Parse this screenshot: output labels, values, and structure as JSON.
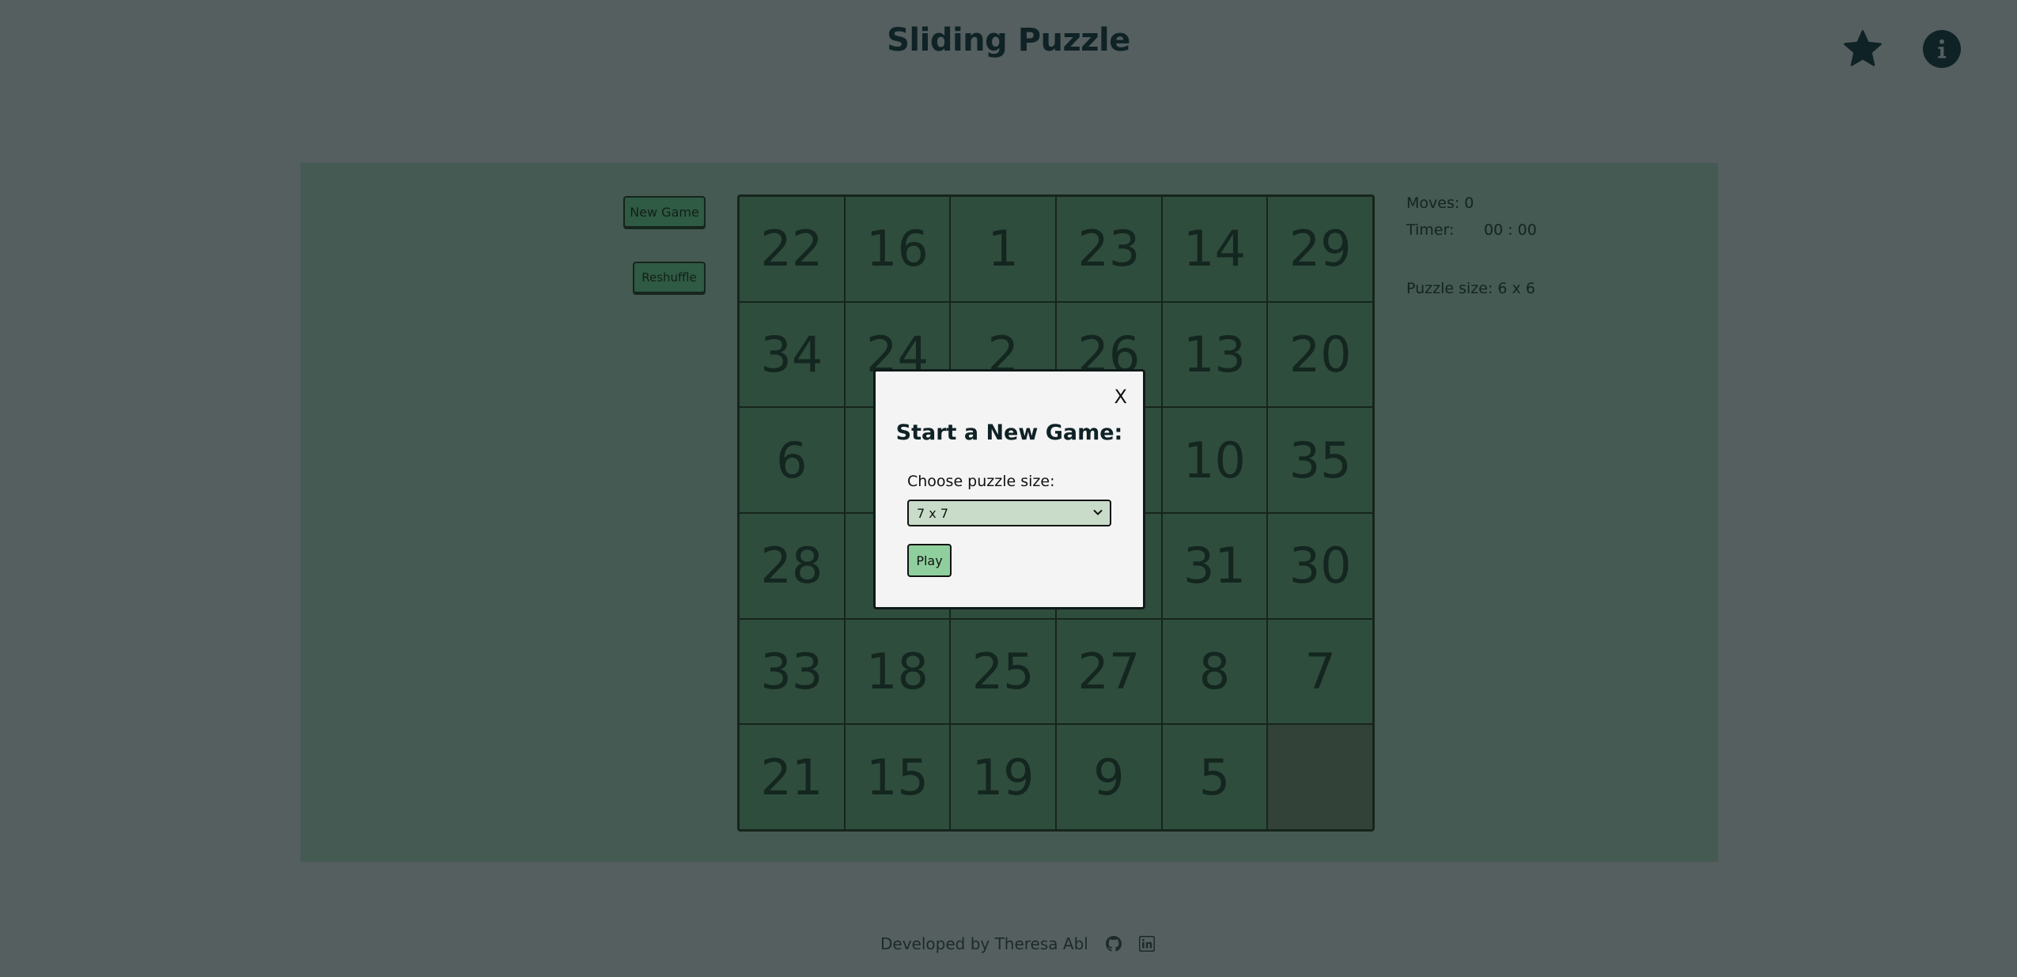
{
  "header": {
    "title": "Sliding Puzzle",
    "star_icon": "star-icon",
    "info_icon": "info-icon"
  },
  "controls": {
    "new_game_label": "New Game",
    "reshuffle_label": "Reshuffle"
  },
  "board": {
    "size": 6,
    "tiles": [
      "22",
      "16",
      "1",
      "23",
      "14",
      "29",
      "34",
      "24",
      "2",
      "26",
      "13",
      "20",
      "6",
      "",
      "",
      "",
      "10",
      "35",
      "28",
      "",
      "",
      "",
      "31",
      "30",
      "33",
      "18",
      "25",
      "27",
      "8",
      "7",
      "21",
      "15",
      "19",
      "9",
      "5",
      ""
    ],
    "empty_index": 35
  },
  "stats": {
    "moves": "Moves: 0",
    "timer_label": "Timer:",
    "timer_value": "00 : 00",
    "puzzle_size": "Puzzle size: 6 x 6"
  },
  "modal": {
    "close_label": "X",
    "title": "Start a New Game:",
    "label": "Choose puzzle size:",
    "selected_size": "7 x 7",
    "play_label": "Play"
  },
  "footer": {
    "credit": "Developed by Theresa Abl",
    "github_icon": "github-icon",
    "linkedin_icon": "linkedin-icon"
  },
  "colors": {
    "page_bg": "#555f5f",
    "panel_bg": "#445a52",
    "tile_bg": "#2f4d3d",
    "modal_bg": "#f4f4f4",
    "select_bg": "#c8dcc9",
    "play_bg": "#8fcf9d"
  }
}
